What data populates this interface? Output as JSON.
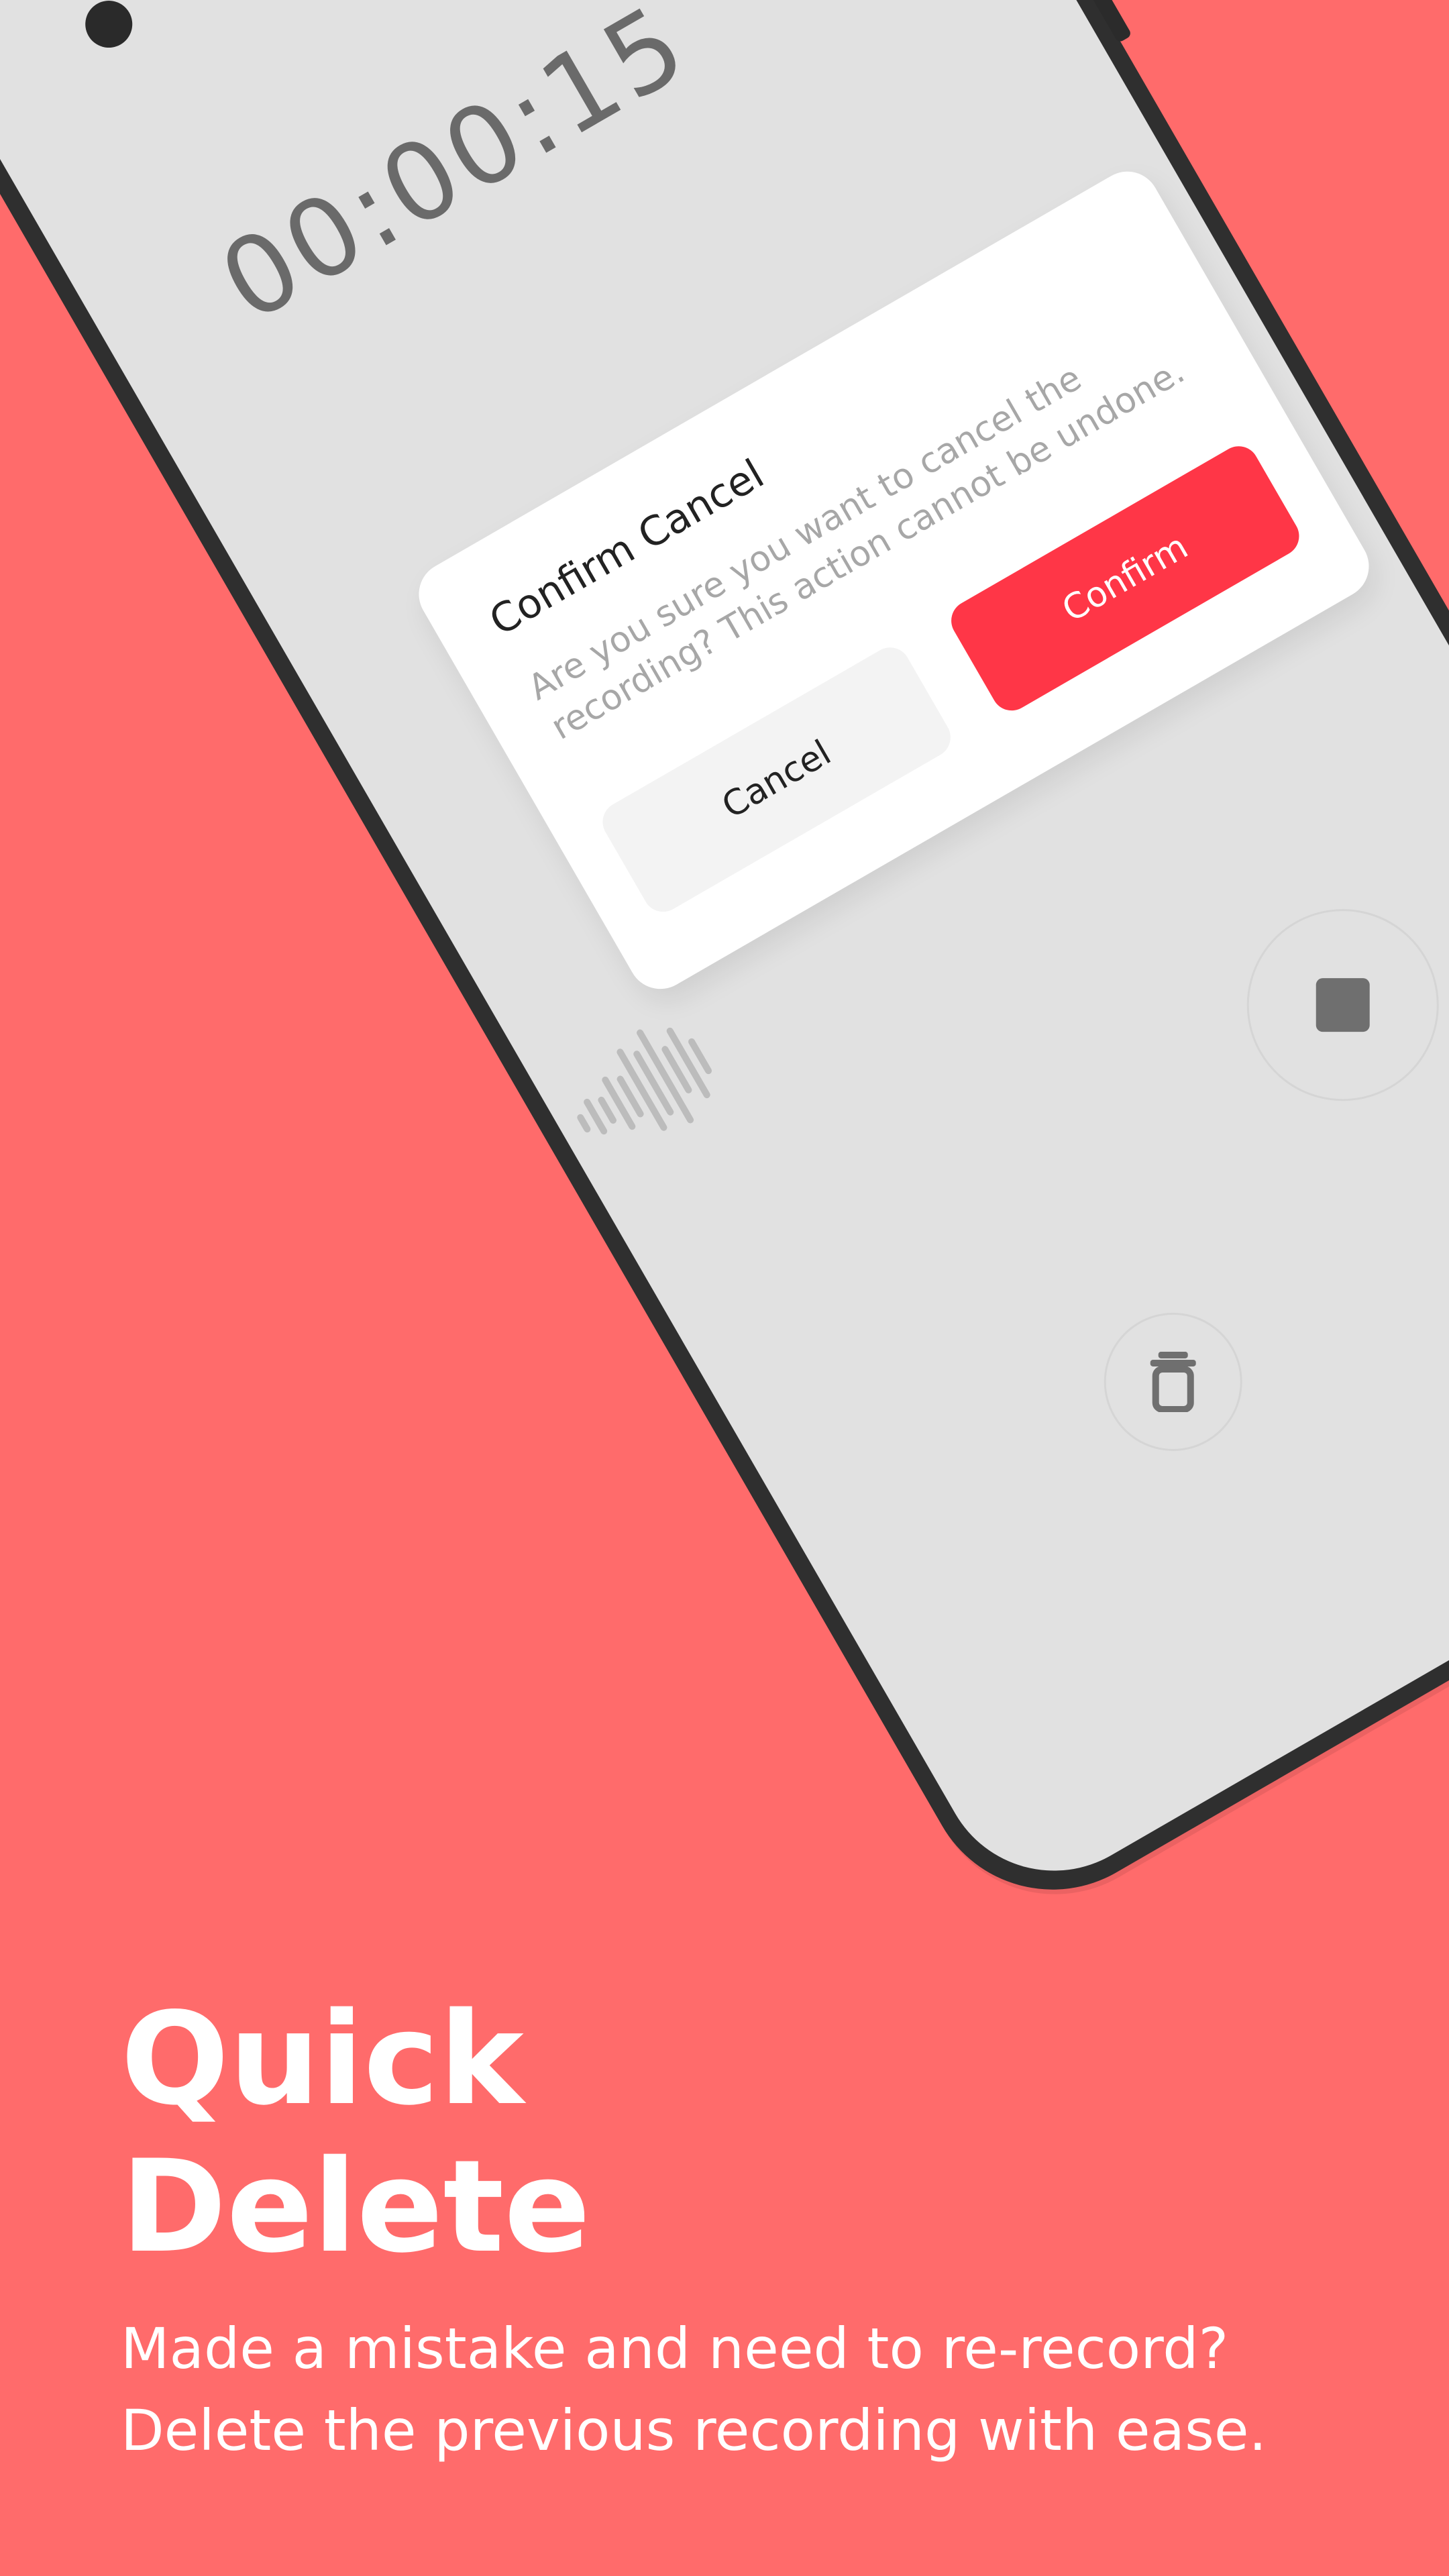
{
  "theme": {
    "background": "#FF6B6B",
    "accent": "#FF3647",
    "phone_frame": "#2F2F2F",
    "screen_bg": "#E1E1E1"
  },
  "recorder": {
    "timer": "00:00:15"
  },
  "dialog": {
    "title": "Confirm Cancel",
    "message": "Are you sure you want to cancel the recording? This action cannot be undone.",
    "cancel_label": "Cancel",
    "confirm_label": "Confirm"
  },
  "controls": {
    "stop_icon": "stop-icon",
    "delete_icon": "trash-icon"
  },
  "promo": {
    "headline_line1": "Quick",
    "headline_line2": "Delete",
    "subtext_line1": "Made a mistake and need to re-record?",
    "subtext_line2": "Delete the previous recording with ease."
  }
}
